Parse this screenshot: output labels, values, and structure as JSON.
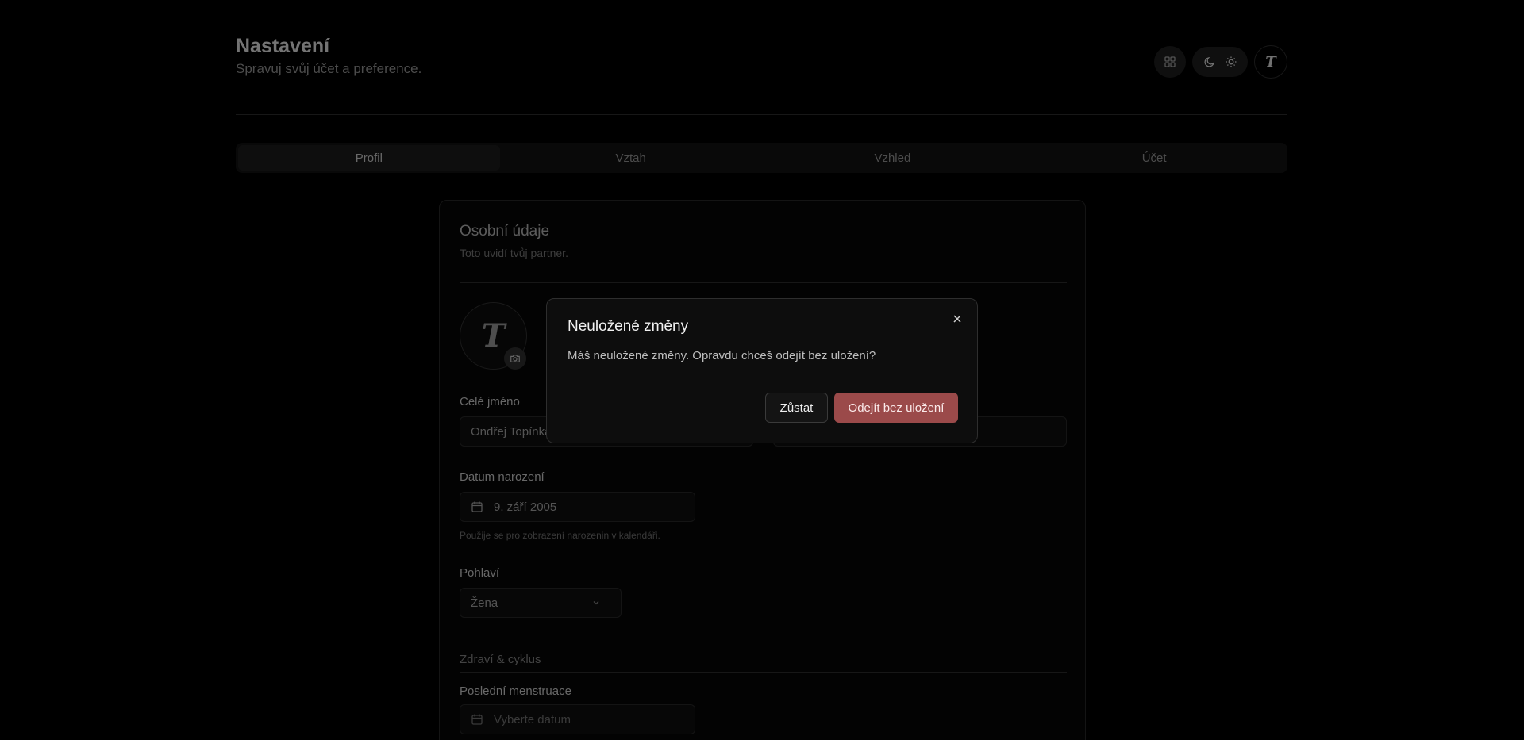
{
  "header": {
    "title": "Nastavení",
    "subtitle": "Spravuj svůj účet a preference.",
    "avatar_initial": "T"
  },
  "tabs": [
    {
      "label": "Profil",
      "active": true
    },
    {
      "label": "Vztah",
      "active": false
    },
    {
      "label": "Vzhled",
      "active": false
    },
    {
      "label": "Účet",
      "active": false
    }
  ],
  "card": {
    "title": "Osobní údaje",
    "subtitle": "Toto uvidí tvůj partner.",
    "avatar_initial": "T",
    "full_name": {
      "label": "Celé jméno",
      "value": "Ondřej Topínka"
    },
    "birth_date": {
      "label": "Datum narození",
      "value": "9. září 2005",
      "hint": "Použije se pro zobrazení narozenin v kalendáři."
    },
    "gender": {
      "label": "Pohlaví",
      "value": "Žena"
    },
    "health_section": "Zdraví & cyklus",
    "last_period": {
      "label": "Poslední menstruace",
      "placeholder": "Vyberte datum"
    }
  },
  "modal": {
    "title": "Neuložené změny",
    "text": "Máš neuložené změny. Opravdu chceš odejít bez uložení?",
    "stay_label": "Zůstat",
    "leave_label": "Odejít bez uložení"
  },
  "colors": {
    "background": "#000000",
    "danger": "#9b4a4a"
  }
}
